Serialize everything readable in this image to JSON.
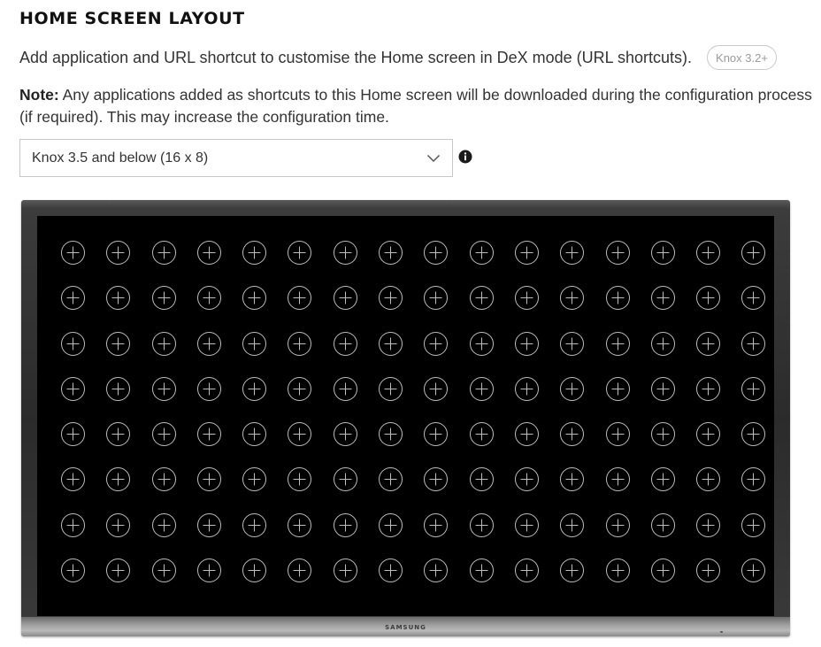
{
  "section": {
    "title": "HOME SCREEN LAYOUT",
    "description": "Add application and URL shortcut to customise the Home screen in DeX mode (URL shortcuts).",
    "badge": "Knox 3.2+",
    "note_label": "Note:",
    "note_text": " Any applications added as shortcuts to this Home screen will be downloaded during the configuration process (if required). This may increase the configuration time."
  },
  "layout_select": {
    "selected": "Knox 3.5 and below (16 x 8)",
    "icon": "chevron-down-icon"
  },
  "info": {
    "icon": "info-icon"
  },
  "monitor": {
    "brand": "SAMSUNG",
    "grid_columns": 16,
    "grid_rows": 8,
    "slot_icon": "add-circle-icon"
  },
  "colors": {
    "screen": "#000000",
    "slot_stroke": "#bdbdbd",
    "text": "#333333"
  }
}
